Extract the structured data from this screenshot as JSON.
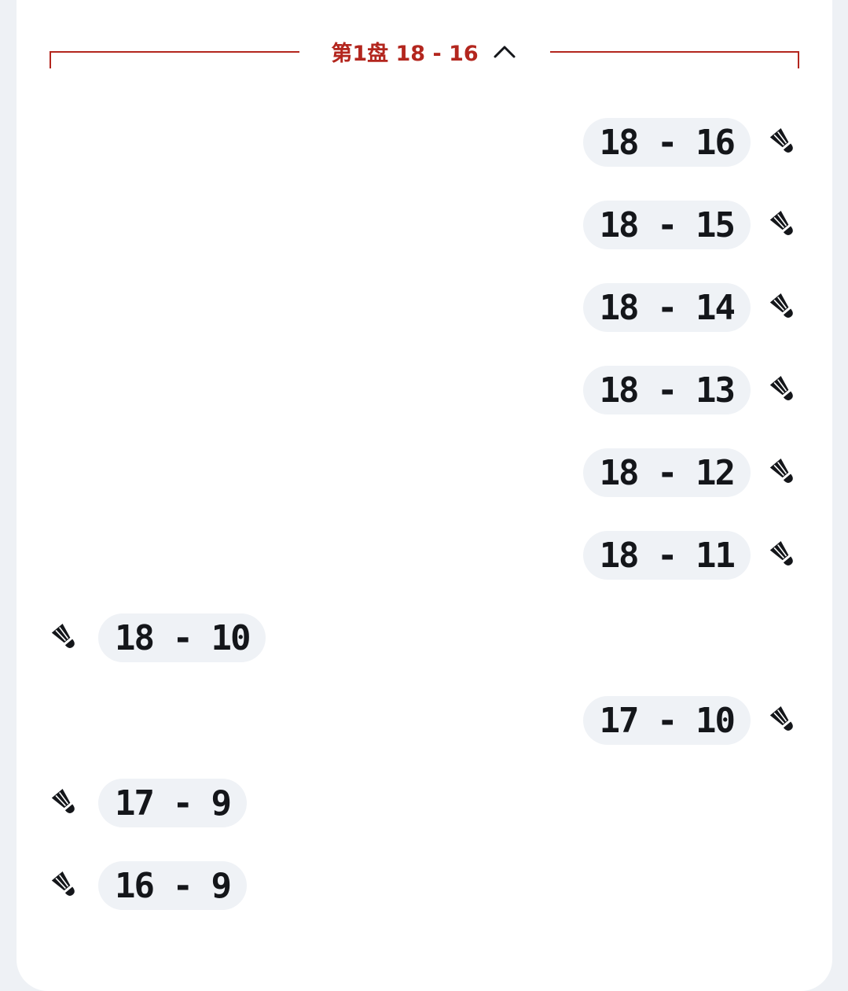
{
  "set_header": {
    "label": "第1盘 18 - 16",
    "expanded": true,
    "accent_color": "#b3261e",
    "toggle_icon": "chevron-up-icon"
  },
  "rallies": [
    {
      "score": "18 - 16",
      "server_side": "right",
      "icon": "shuttlecock-icon"
    },
    {
      "score": "18 - 15",
      "server_side": "right",
      "icon": "shuttlecock-icon"
    },
    {
      "score": "18 - 14",
      "server_side": "right",
      "icon": "shuttlecock-icon"
    },
    {
      "score": "18 - 13",
      "server_side": "right",
      "icon": "shuttlecock-icon"
    },
    {
      "score": "18 - 12",
      "server_side": "right",
      "icon": "shuttlecock-icon"
    },
    {
      "score": "18 - 11",
      "server_side": "right",
      "icon": "shuttlecock-icon"
    },
    {
      "score": "18 - 10",
      "server_side": "left",
      "icon": "shuttlecock-icon"
    },
    {
      "score": "17 - 10",
      "server_side": "right",
      "icon": "shuttlecock-icon"
    },
    {
      "score": "17 - 9",
      "server_side": "left",
      "icon": "shuttlecock-icon"
    },
    {
      "score": "16 - 9",
      "server_side": "left",
      "icon": "shuttlecock-icon"
    }
  ]
}
